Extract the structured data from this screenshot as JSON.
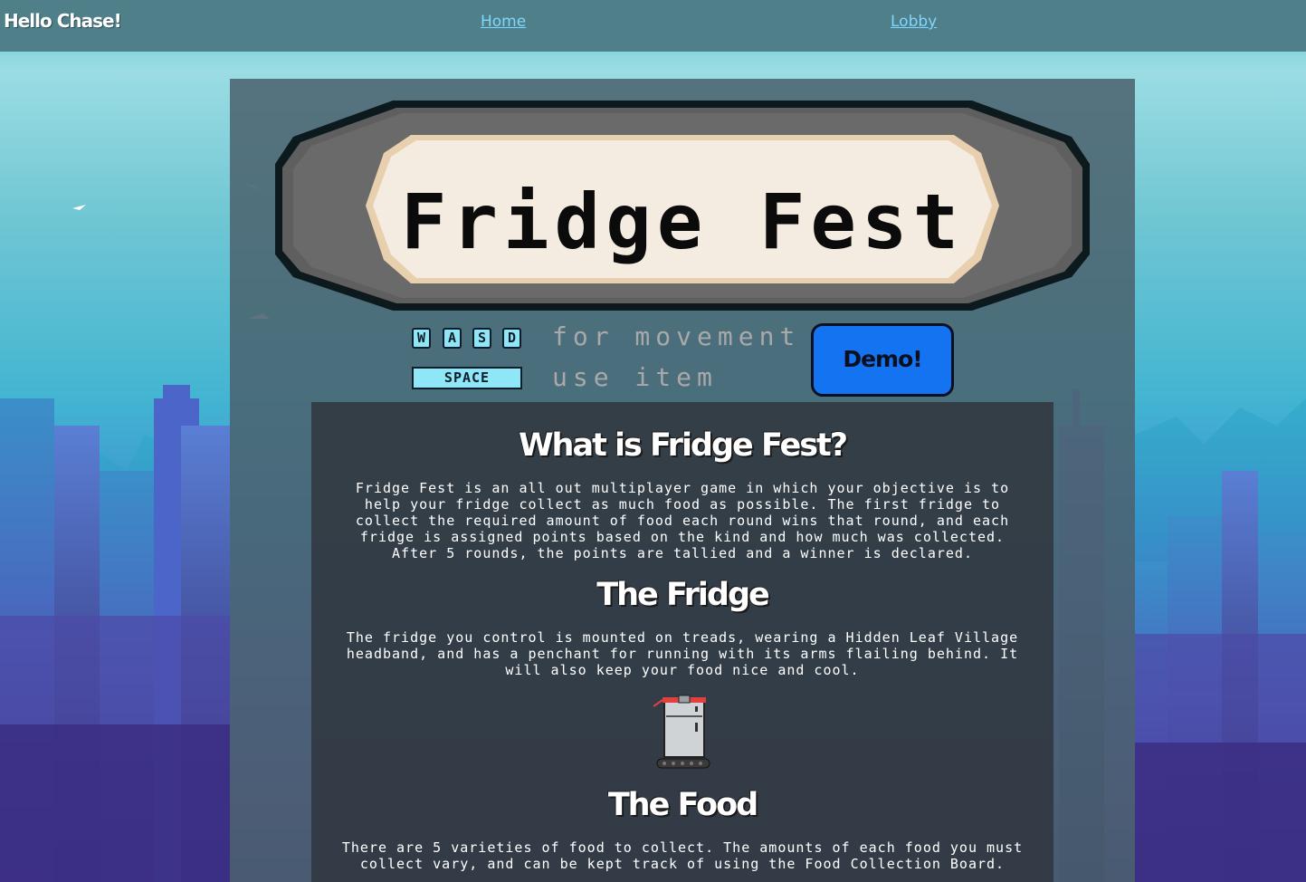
{
  "nav": {
    "greeting": "Hello Chase!",
    "home_label": "Home",
    "lobby_label": "Lobby"
  },
  "banner": {
    "title": "Fridge Fest"
  },
  "controls": {
    "keys": [
      "W",
      "A",
      "S",
      "D"
    ],
    "movement_text": "for movement",
    "space_key": "SPACE",
    "item_text": "use item"
  },
  "demo_button": {
    "label": "Demo!"
  },
  "info": {
    "what_heading": "What is Fridge Fest?",
    "what_body": "Fridge Fest is an all out multiplayer game in which your objective is to help your fridge collect as much food as possible. The first fridge to collect the required amount of food each round wins that round, and each fridge is assigned points based on the kind and how much was collected. After 5 rounds, the points are tallied and a winner is declared.",
    "fridge_heading": "The Fridge",
    "fridge_body": "The fridge you control is mounted on treads, wearing a Hidden Leaf Village headband, and has a penchant for running with its arms flailing behind. It will also keep your food nice and cool.",
    "food_heading": "The Food",
    "food_body": "There are 5 varieties of food to collect. The amounts of each food you must collect vary, and can be kept track of using the Food Collection Board."
  },
  "colors": {
    "topbar": "#4f7f88",
    "link": "#7fd6ff",
    "demo_button": "#1473f0",
    "key_fill": "#8ee6f6",
    "banner_plate": "#f4ece0",
    "banner_frame": "#5f5f5f"
  },
  "icons": {
    "fridge_sprite": "fridge-character-icon"
  }
}
